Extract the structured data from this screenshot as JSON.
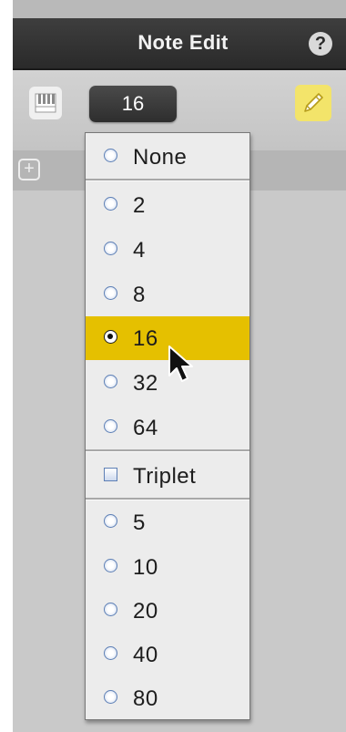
{
  "window": {
    "title": "Note Edit"
  },
  "header": {
    "help_icon": "?"
  },
  "toolbar": {
    "quantize_value": "16",
    "piano_roll_icon": "piano-keys",
    "pencil_icon": "pencil",
    "pencil_accent_color": "#f3e46a"
  },
  "add_button": {
    "icon": "+"
  },
  "dropdown": {
    "selected": "16",
    "highlight_color": "#e5c000",
    "items": [
      {
        "label": "None",
        "kind": "radio",
        "checked": false
      },
      {
        "label": "2",
        "kind": "radio",
        "checked": false
      },
      {
        "label": "4",
        "kind": "radio",
        "checked": false
      },
      {
        "label": "8",
        "kind": "radio",
        "checked": false
      },
      {
        "label": "16",
        "kind": "radio",
        "checked": true
      },
      {
        "label": "32",
        "kind": "radio",
        "checked": false
      },
      {
        "label": "64",
        "kind": "radio",
        "checked": false
      },
      {
        "label": "Triplet",
        "kind": "checkbox",
        "checked": false
      },
      {
        "label": "5",
        "kind": "radio",
        "checked": false
      },
      {
        "label": "10",
        "kind": "radio",
        "checked": false
      },
      {
        "label": "20",
        "kind": "radio",
        "checked": false
      },
      {
        "label": "40",
        "kind": "radio",
        "checked": false
      },
      {
        "label": "80",
        "kind": "radio",
        "checked": false
      }
    ]
  }
}
